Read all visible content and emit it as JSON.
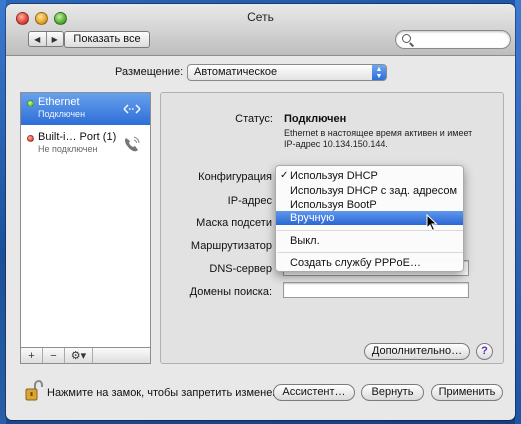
{
  "window": {
    "title": "Сеть"
  },
  "toolbar": {
    "back_glyph": "◀",
    "forward_glyph": "▶",
    "show_all_label": "Показать все",
    "search_placeholder": ""
  },
  "location": {
    "label": "Размещение:",
    "value": "Автоматическое"
  },
  "services": [
    {
      "name": "Ethernet",
      "status": "Подключен",
      "status_color": "#3ab61c",
      "icon": "ethernet-arrows-icon"
    },
    {
      "name": "Built-i… Port (1)",
      "status": "Не подключен",
      "status_color": "#d61e10",
      "icon": "phone-modem-icon"
    }
  ],
  "sidebar_controls": {
    "add": "+",
    "remove": "−",
    "gear": "⚙▾"
  },
  "status": {
    "label": "Статус:",
    "value": "Подключен",
    "description": "Ethernet в настоящее время активен и имеет IP-адрес 10.134.150.144."
  },
  "fields": {
    "config_label": "Конфигурация",
    "ip_label": "IP-адрес",
    "mask_label": "Маска подсети",
    "router_label": "Маршрутизатор",
    "dns_label": "DNS-сервер",
    "search_domains_label": "Домены поиска:"
  },
  "config_menu": {
    "check_glyph": "✓",
    "items": [
      {
        "label": "Используя DHCP",
        "checked": true
      },
      {
        "label": "Используя DHCP с зад. адресом"
      },
      {
        "label": "Используя BootP"
      },
      {
        "label": "Вручную",
        "highlighted": true
      },
      {
        "label": "Выкл."
      },
      {
        "label": "Создать службу PPPoE…"
      }
    ]
  },
  "buttons": {
    "advanced": "Дополнительно…",
    "help": "?",
    "assistant": "Ассистент…",
    "revert": "Вернуть",
    "apply": "Применить"
  },
  "lock": {
    "text": "Нажмите на замок, чтобы запретить изменения."
  },
  "colors": {
    "selection": "#2d6fd8",
    "desktop": "#1d4f9c"
  }
}
